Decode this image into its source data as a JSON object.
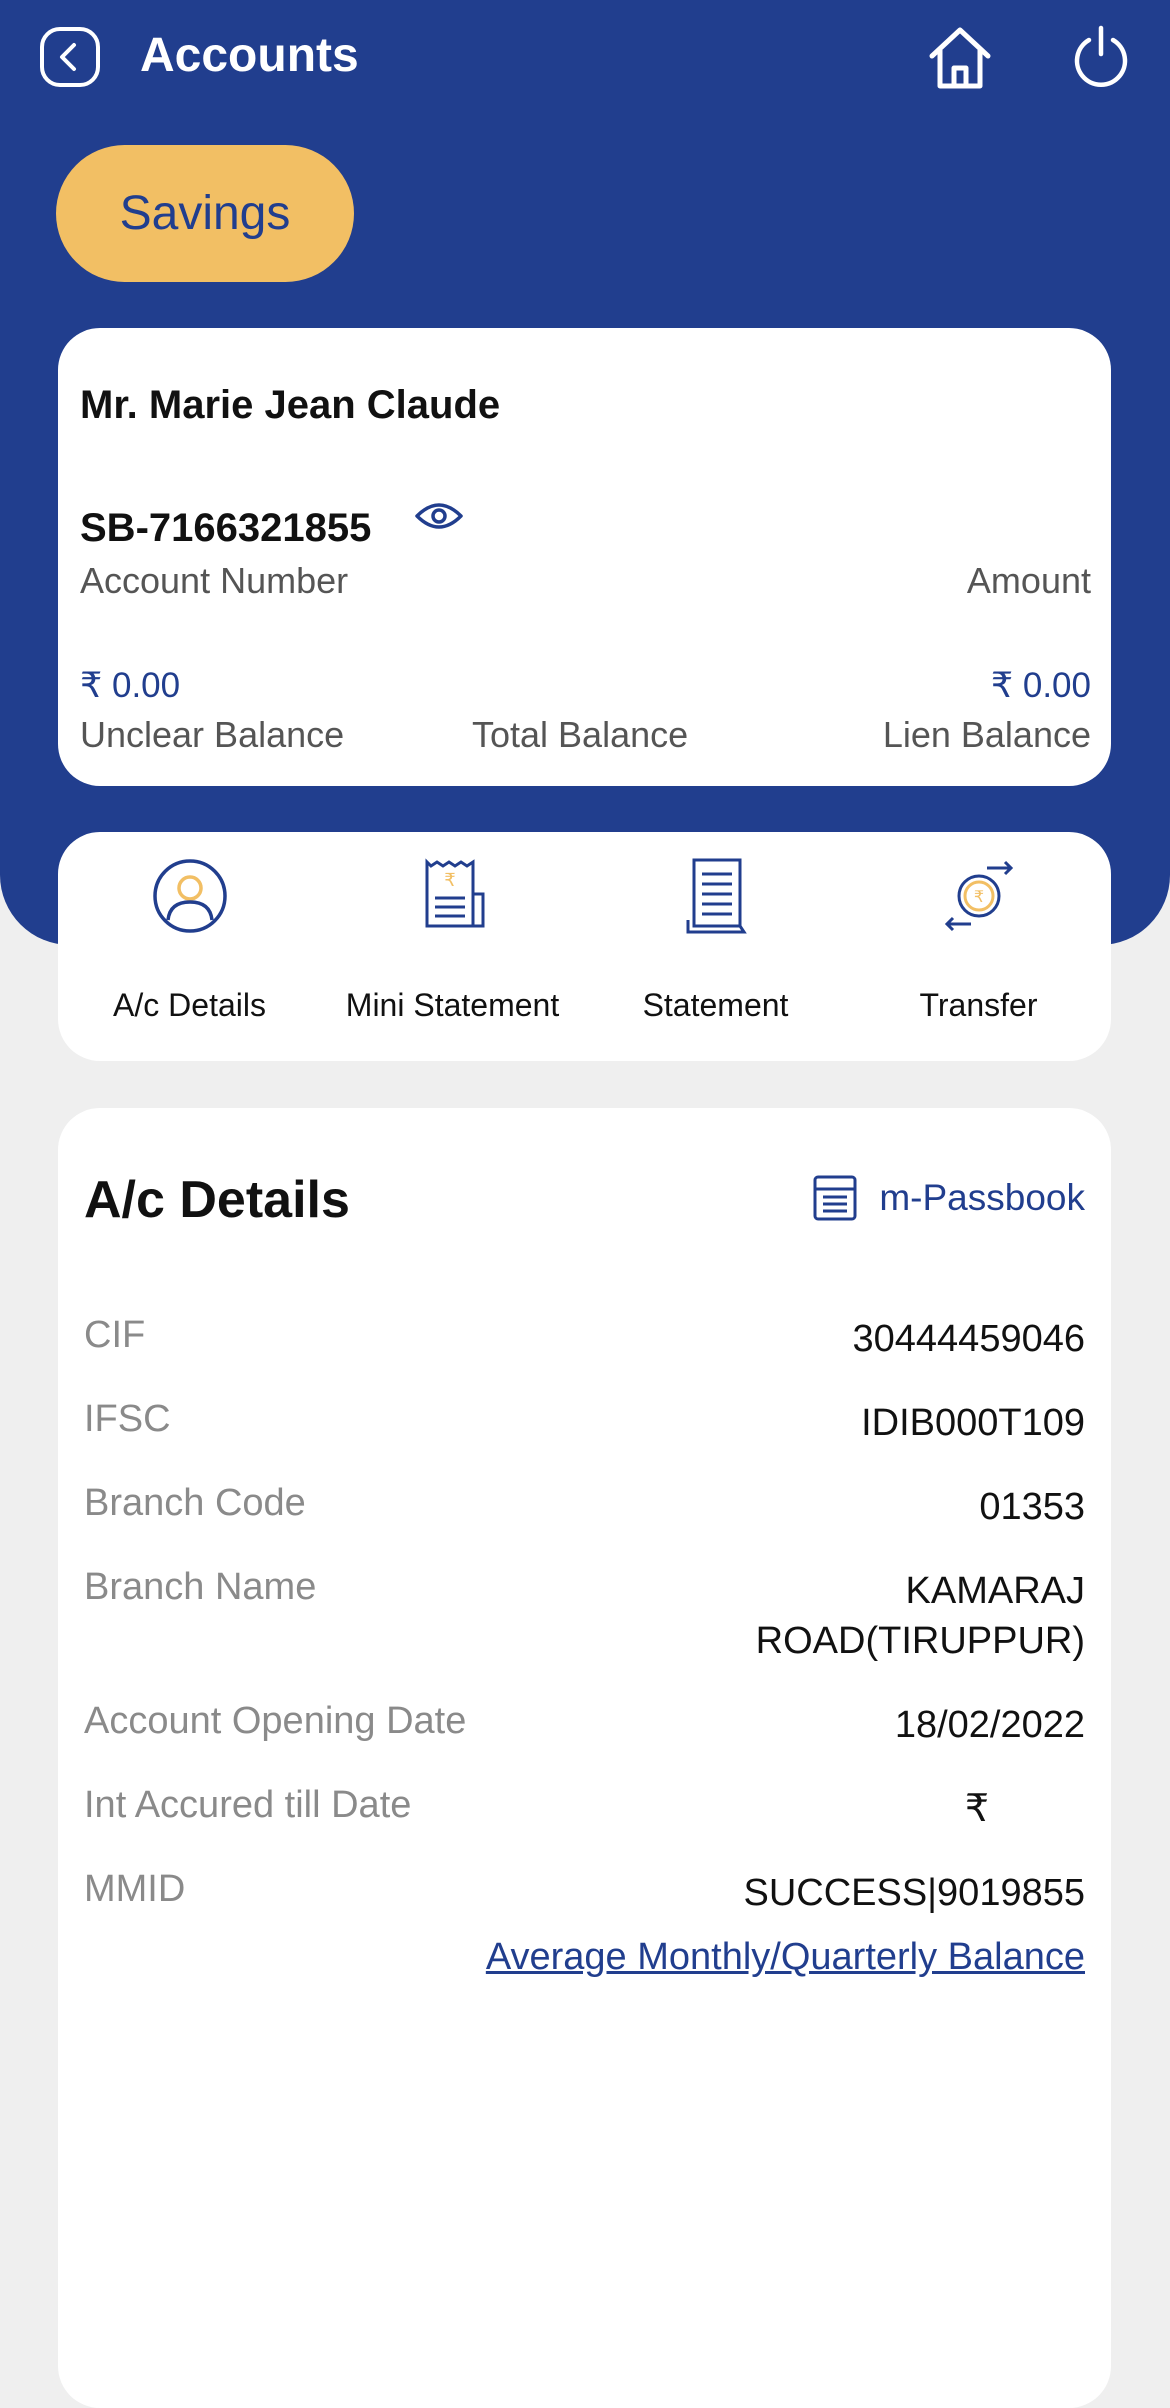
{
  "header": {
    "title": "Accounts",
    "back_icon": "chevron-left-icon",
    "home_icon": "home-icon",
    "power_icon": "power-icon"
  },
  "account_type_tab": "Savings",
  "account_card": {
    "holder_name": "Mr. Marie Jean Claude",
    "account_number": "SB-7166321855",
    "account_number_label": "Account Number",
    "amount_label": "Amount",
    "unclear_balance_value": "₹ 0.00",
    "unclear_balance_label": "Unclear Balance",
    "total_balance_label": "Total Balance",
    "lien_balance_value": "₹ 0.00",
    "lien_balance_label": "Lien Balance"
  },
  "quick_actions": [
    {
      "label": "A/c Details",
      "icon": "user-circle-icon"
    },
    {
      "label": "Mini Statement",
      "icon": "receipt-icon"
    },
    {
      "label": "Statement",
      "icon": "document-icon"
    },
    {
      "label": "Transfer",
      "icon": "transfer-icon"
    }
  ],
  "details": {
    "title": "A/c Details",
    "passbook_label": "m-Passbook",
    "rows": [
      {
        "label": "CIF",
        "value": "30444459046"
      },
      {
        "label": "IFSC",
        "value": "IDIB000T109"
      },
      {
        "label": "Branch Code",
        "value": "01353"
      },
      {
        "label": "Branch Name",
        "value": "KAMARAJ ROAD(TIRUPPUR)"
      },
      {
        "label": "Account Opening Date",
        "value": "18/02/2022"
      },
      {
        "label": "Int Accured till Date",
        "value": "₹"
      },
      {
        "label": "MMID",
        "value": "SUCCESS|9019855"
      }
    ],
    "avg_balance_link": "Average Monthly/Quarterly Balance"
  },
  "colors": {
    "primary": "#213e8e",
    "accent": "#f2bf64",
    "background": "#efefef"
  }
}
